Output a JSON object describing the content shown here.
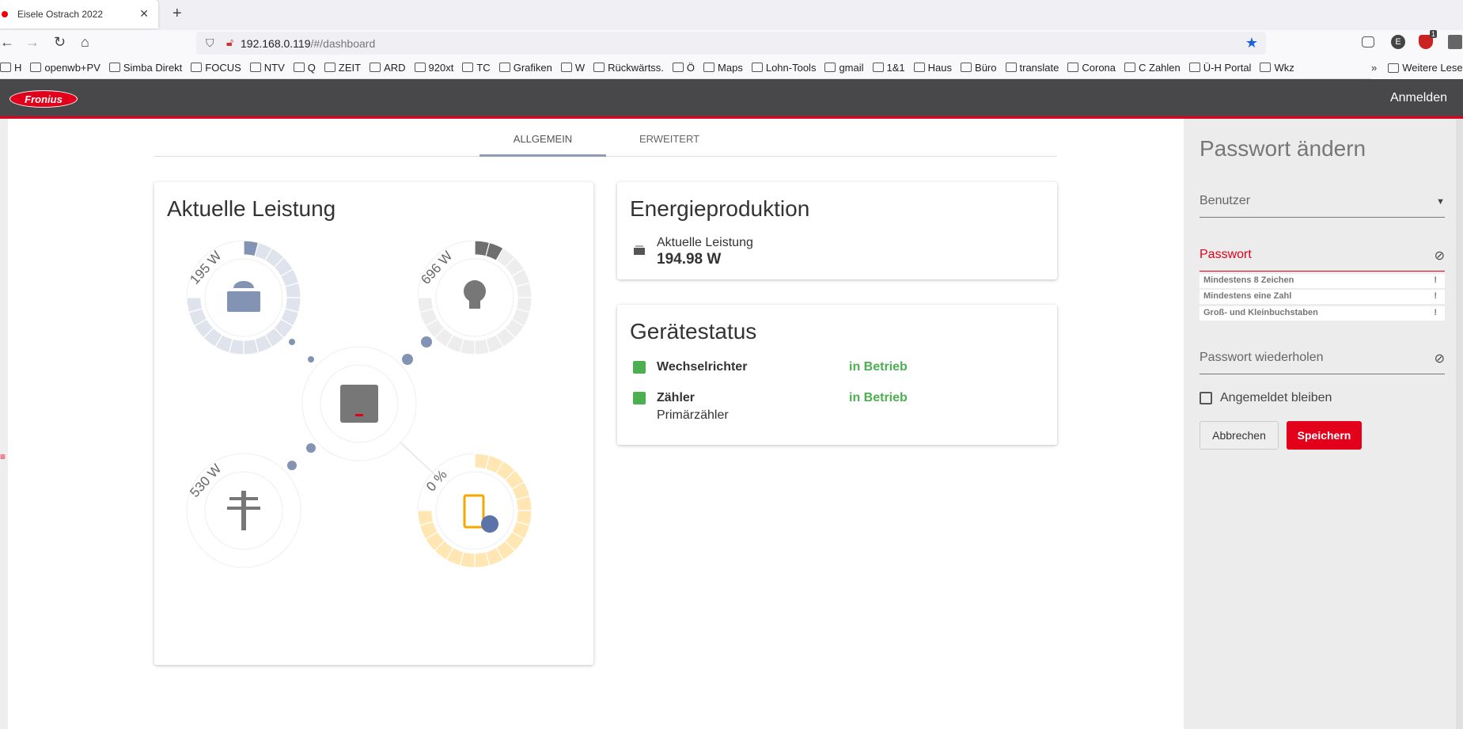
{
  "browser": {
    "tab_title": "Eisele Ostrach 2022",
    "url_host": "192.168.0.119",
    "url_path": "/#/dashboard",
    "extension_badge": "1",
    "extension_letter": "E",
    "bookmarks": [
      "H",
      "openwb+PV",
      "Simba Direkt",
      "FOCUS",
      "NTV",
      "Q",
      "ZEIT",
      "ARD",
      "920xt",
      "TC",
      "Grafiken",
      "W",
      "Rückwärtss.",
      "Ö",
      "Maps",
      "Lohn-Tools",
      "gmail",
      "1&1",
      "Haus",
      "Büro",
      "translate",
      "Corona",
      "C Zahlen",
      "Ü-H Portal",
      "Wkz"
    ],
    "more_bookmarks": "Weitere Lese"
  },
  "header": {
    "logo": "Fronius",
    "login": "Anmelden"
  },
  "tabs": [
    {
      "label": "ALLGEMEIN",
      "active": true
    },
    {
      "label": "ERWEITERT",
      "active": false
    }
  ],
  "power": {
    "title": "Aktuelle Leistung",
    "pv": {
      "label": "195 W",
      "level": 0.05
    },
    "load": {
      "label": "696 W",
      "level": 0.11
    },
    "grid": {
      "label": "530 W"
    },
    "battery": {
      "label": "0 %",
      "level": 0
    }
  },
  "energy": {
    "title": "Energieproduktion",
    "label": "Aktuelle Leistung",
    "value": "194.98 W"
  },
  "status": {
    "title": "Gerätestatus",
    "devices": [
      {
        "name": "Wechselrichter",
        "sub": "",
        "state": "in Betrieb"
      },
      {
        "name": "Zähler",
        "sub": "Primärzähler",
        "state": "in Betrieb"
      }
    ]
  },
  "colors": {
    "accent": "#e2001a",
    "ok": "#4caf50",
    "pv": "#8393b3",
    "battery": "#ffe6b3"
  },
  "password": {
    "title": "Passwort ändern",
    "user_label": "Benutzer",
    "password_label": "Passwort",
    "rules": [
      "Mindestens 8 Zeichen",
      "Mindestens eine Zahl",
      "Groß- und Kleinbuchstaben"
    ],
    "rule_mark": "!",
    "repeat_label": "Passwort wiederholen",
    "remember_label": "Angemeldet bleiben",
    "remember_checked": false,
    "cancel": "Abbrechen",
    "save": "Speichern"
  }
}
